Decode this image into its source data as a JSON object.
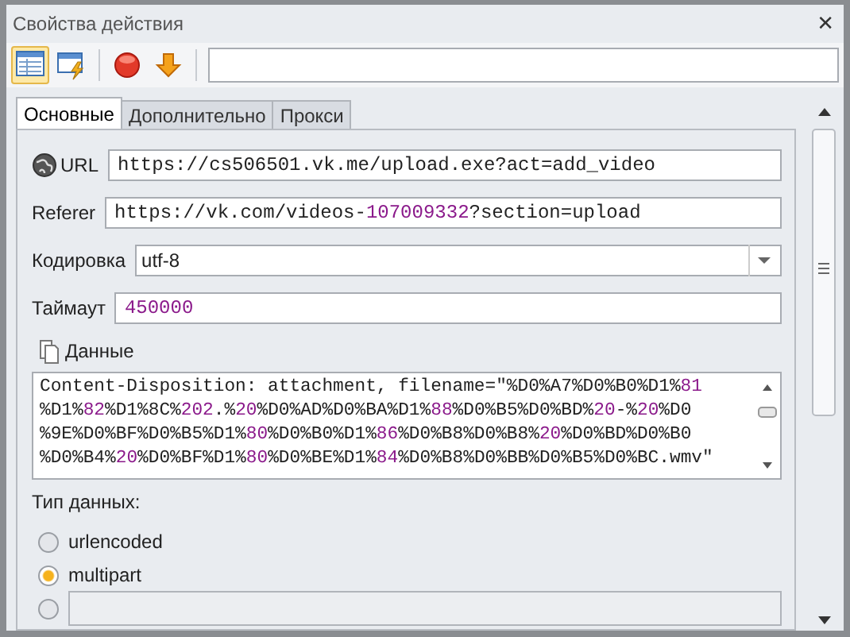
{
  "window": {
    "title": "Свойства действия",
    "close": "✕"
  },
  "toolbar": {
    "buttons": [
      {
        "kind": "table",
        "selected": true
      },
      {
        "kind": "window",
        "selected": false
      },
      {
        "kind": "stop",
        "selected": false
      },
      {
        "kind": "down",
        "selected": false
      }
    ]
  },
  "tabs": [
    {
      "label": "Основные",
      "selected": true
    },
    {
      "label": "Дополнительно",
      "selected": false
    },
    {
      "label": "Прокси",
      "selected": false
    }
  ],
  "fields": [
    {
      "kind": "url",
      "label": "URL",
      "segments": [
        {
          "text": "https://cs506501.vk.me/upload.exe?act=add_video",
          "kind": "plain"
        }
      ]
    },
    {
      "kind": "text",
      "label": "Referer",
      "segments": [
        {
          "text": "https://vk.com/videos-",
          "kind": "plain"
        },
        {
          "text": "107009332",
          "kind": "number"
        },
        {
          "text": "?section=upload",
          "kind": "plain"
        }
      ]
    },
    {
      "kind": "select",
      "label": "Кодировка",
      "value": "utf-8"
    },
    {
      "kind": "text",
      "label": "Таймаут",
      "segments": [
        {
          "text": "450000",
          "kind": "number"
        }
      ]
    }
  ],
  "data": {
    "label": "Данные",
    "lines": [
      [
        {
          "text": "Content-Disposition: attachment, filename=\"%D0%A7%D0%B0%D1%",
          "kind": "plain"
        },
        {
          "text": "81",
          "kind": "number"
        }
      ],
      [
        {
          "text": "%D1%",
          "kind": "plain"
        },
        {
          "text": "82",
          "kind": "number"
        },
        {
          "text": "%D1%8C%",
          "kind": "plain"
        },
        {
          "text": "202",
          "kind": "number"
        },
        {
          "text": ".%",
          "kind": "plain"
        },
        {
          "text": "20",
          "kind": "number"
        },
        {
          "text": "%D0%AD%D0%BA%D1%",
          "kind": "plain"
        },
        {
          "text": "88",
          "kind": "number"
        },
        {
          "text": "%D0%B5%D0%BD%",
          "kind": "plain"
        },
        {
          "text": "20",
          "kind": "number"
        },
        {
          "text": "-%",
          "kind": "plain"
        },
        {
          "text": "20",
          "kind": "number"
        },
        {
          "text": "%D0",
          "kind": "plain"
        }
      ],
      [
        {
          "text": "%9E%D0%BF%D0%B5%D1%",
          "kind": "plain"
        },
        {
          "text": "80",
          "kind": "number"
        },
        {
          "text": "%D0%B0%D1%",
          "kind": "plain"
        },
        {
          "text": "86",
          "kind": "number"
        },
        {
          "text": "%D0%B8%D0%B8%",
          "kind": "plain"
        },
        {
          "text": "20",
          "kind": "number"
        },
        {
          "text": "%D0%BD%D0%B0",
          "kind": "plain"
        }
      ],
      [
        {
          "text": "%D0%B4%",
          "kind": "plain"
        },
        {
          "text": "20",
          "kind": "number"
        },
        {
          "text": "%D0%BF%D1%",
          "kind": "plain"
        },
        {
          "text": "80",
          "kind": "number"
        },
        {
          "text": "%D0%BE%D1%",
          "kind": "plain"
        },
        {
          "text": "84",
          "kind": "number"
        },
        {
          "text": "%D0%B8%D0%BB%D0%B5%D0%BC.wmv\"",
          "kind": "plain"
        }
      ]
    ]
  },
  "data_type": {
    "label": "Тип данных:",
    "options": [
      {
        "kind": "label",
        "label": "urlencoded",
        "selected": false
      },
      {
        "kind": "label",
        "label": "multipart",
        "selected": true
      },
      {
        "kind": "field",
        "selected": false
      }
    ]
  }
}
